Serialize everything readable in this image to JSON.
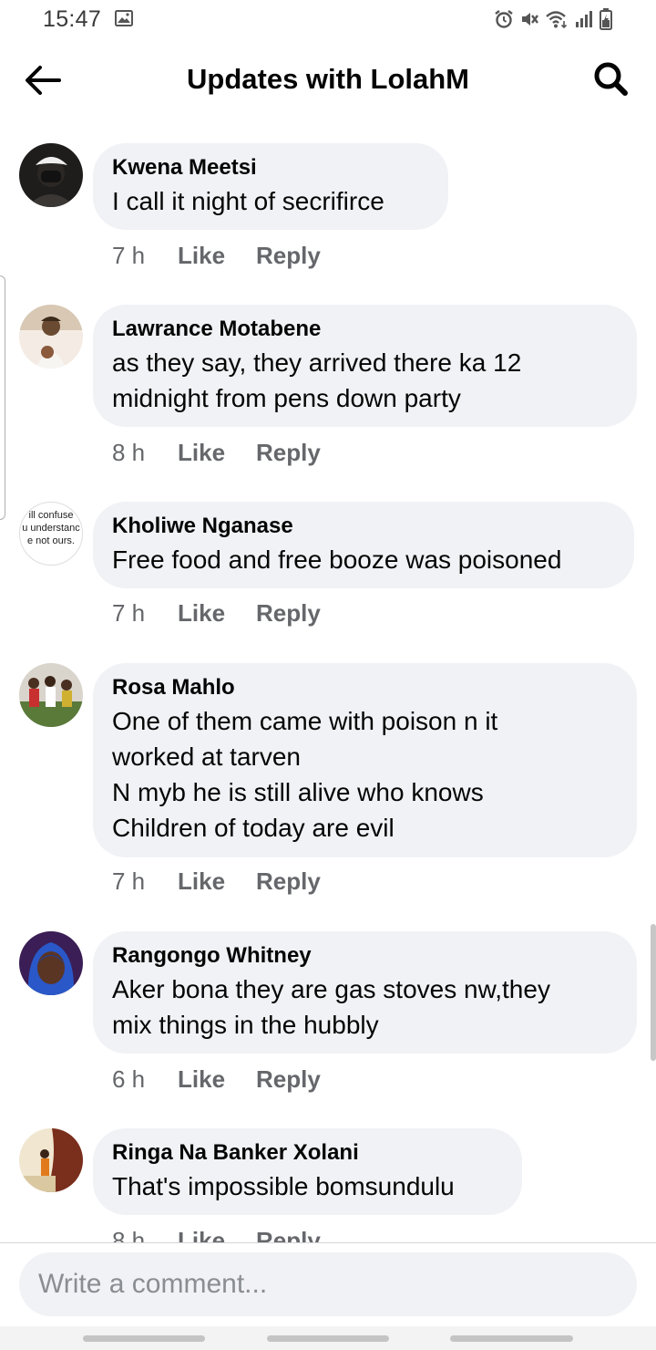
{
  "status_bar": {
    "time": "15:47",
    "icons": [
      "gallery-icon",
      "alarm-icon",
      "mute-icon",
      "wifi-icon",
      "signal-icon",
      "battery-icon"
    ]
  },
  "header": {
    "title": "Updates with LolahM",
    "back_icon": "back-arrow-icon",
    "search_icon": "search-icon"
  },
  "comments": [
    {
      "author": "Kwena Meetsi",
      "text": "I call it night of secrifirce",
      "time": "7 h",
      "like": "Like",
      "reply": "Reply"
    },
    {
      "author": "Lawrance Motabene",
      "text": "as they say, they arrived there ka 12\nmidnight from pens down party",
      "time": "8 h",
      "like": "Like",
      "reply": "Reply"
    },
    {
      "author": "Kholiwe Nganase",
      "text": "Free food and free booze was poisoned",
      "time": "7 h",
      "like": "Like",
      "reply": "Reply",
      "avatar_text": [
        "ill confuse",
        "u understanc",
        "e not ours."
      ]
    },
    {
      "author": "Rosa Mahlo",
      "text": "One of them came with poison n it\nworked at tarven\nN myb he is still alive who knows\nChildren of today are evil",
      "time": "7 h",
      "like": "Like",
      "reply": "Reply"
    },
    {
      "author": "Rangongo Whitney",
      "text": "Aker bona they are gas stoves nw,they\nmix things in the hubbly",
      "time": "6 h",
      "like": "Like",
      "reply": "Reply"
    },
    {
      "author": "Ringa Na Banker Xolani",
      "text": "That's impossible bomsundulu",
      "time": "8 h",
      "like": "Like",
      "reply": "Reply"
    }
  ],
  "composer": {
    "placeholder": "Write a comment..."
  },
  "colors": {
    "bubble": "#f0f2f5",
    "meta": "#65676b",
    "text": "#050505"
  }
}
